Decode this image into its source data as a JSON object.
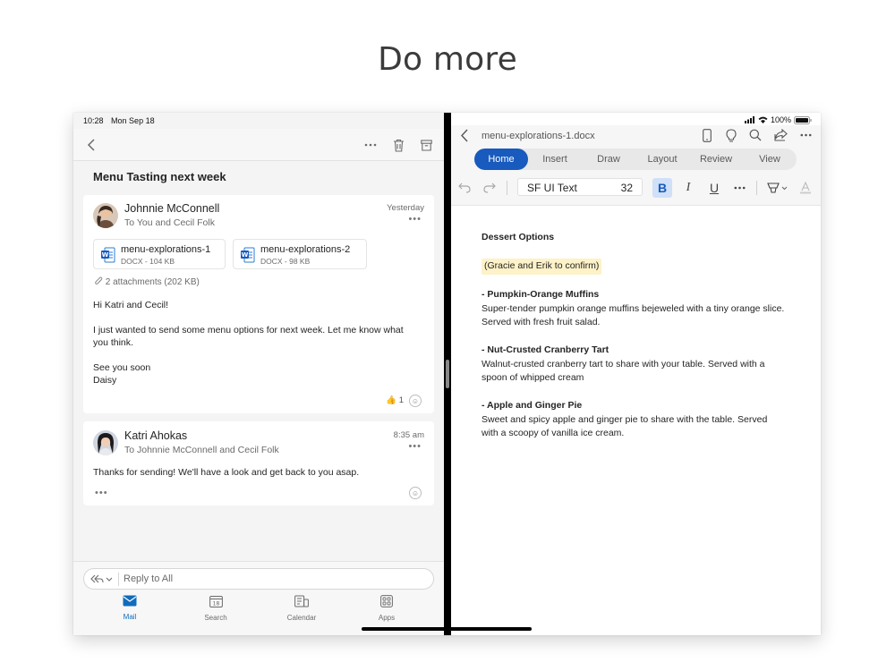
{
  "headline": "Do more",
  "mail": {
    "status": {
      "time": "10:28",
      "date": "Mon Sep 18"
    },
    "subject": "Menu Tasting next week",
    "messages": [
      {
        "sender": "Johnnie McConnell",
        "recipients": "To You and Cecil Folk",
        "time": "Yesterday",
        "attachments": [
          {
            "name": "menu-explorations-1",
            "meta": "DOCX - 104 KB"
          },
          {
            "name": "menu-explorations-2",
            "meta": "DOCX - 98 KB"
          }
        ],
        "attachment_summary": "2 attachments (202 KB)",
        "body": {
          "greeting": "Hi Katri and Cecil!",
          "paragraph": "I just wanted to send some menu options for next week. Let me know what you think.",
          "closing": "See you soon",
          "signature": "Daisy"
        },
        "reaction": {
          "emoji": "👍",
          "count": "1"
        }
      },
      {
        "sender": "Katri Ahokas",
        "recipients": "To Johnnie McConnell and Cecil Folk",
        "time": "8:35 am",
        "body": "Thanks for sending! We'll have a look and get back to you asap."
      }
    ],
    "reply_placeholder": "Reply to All",
    "tabs": [
      {
        "label": "Mail",
        "icon": "mail-icon",
        "active": true
      },
      {
        "label": "Search",
        "icon": "search-calendar-icon",
        "active": false
      },
      {
        "label": "Calendar",
        "icon": "calendar-icon",
        "active": false
      },
      {
        "label": "Apps",
        "icon": "apps-icon",
        "active": false
      }
    ],
    "accent": "#0f6cbd"
  },
  "word": {
    "status": {
      "battery": "100%"
    },
    "doc_title": "menu-explorations-1.docx",
    "ribbon_tabs": [
      "Home",
      "Insert",
      "Draw",
      "Layout",
      "Review",
      "View"
    ],
    "active_tab": "Home",
    "font_name": "SF UI Text",
    "font_size": "32",
    "accent": "#185abd",
    "document": {
      "heading": "Dessert Options",
      "note": "(Gracie and Erik to confirm)",
      "items": [
        {
          "title": "- Pumpkin-Orange Muffins",
          "desc": "Super-tender pumpkin orange muffins bejeweled with a tiny orange slice. Served with fresh fruit salad."
        },
        {
          "title": "- Nut-Crusted Cranberry Tart",
          "desc": "Walnut-crusted cranberry tart to share with your table. Served with a spoon of whipped cream"
        },
        {
          "title": "- Apple and Ginger Pie",
          "desc": "Sweet and spicy apple and ginger pie to share with the table. Served with a scoopy of vanilla ice cream."
        }
      ]
    }
  }
}
